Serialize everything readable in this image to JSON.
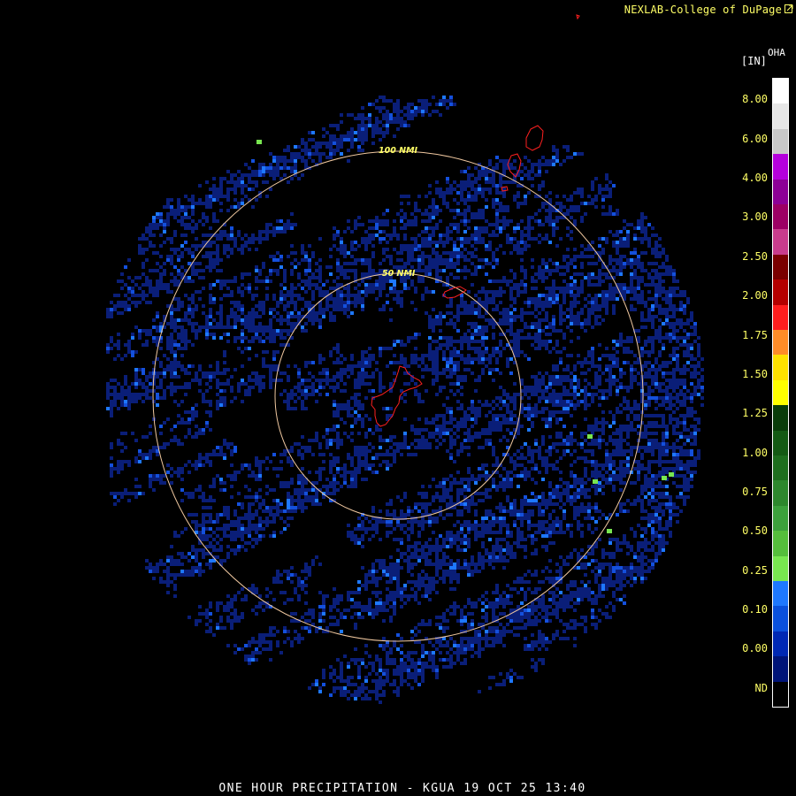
{
  "header": {
    "credit": "NEXLAB-College of DuPage",
    "credit_icon": "external-link-icon"
  },
  "title": "ONE HOUR PRECIPITATION - KGUA 19 OCT 25 13:40",
  "legend": {
    "unit": "[IN]",
    "product": "OHA",
    "labels": [
      "8.00",
      "6.00",
      "4.00",
      "3.00",
      "2.50",
      "2.00",
      "1.75",
      "1.50",
      "1.25",
      "1.00",
      "0.75",
      "0.50",
      "0.25",
      "0.10",
      "0.00",
      "ND"
    ],
    "colors": [
      "#ffffff",
      "#e6e6e6",
      "#c8c8c8",
      "#b400dc",
      "#8c0096",
      "#9c0064",
      "#c83c8c",
      "#7a0000",
      "#b40000",
      "#ff1e1e",
      "#ff8c28",
      "#ffe100",
      "#ffff00",
      "#0a3c0a",
      "#145a14",
      "#1e6e1e",
      "#2d872d",
      "#3ca03c",
      "#55be3c",
      "#78e650",
      "#1e78ff",
      "#0a50dc",
      "#0028b4",
      "#001478",
      "#000000"
    ]
  },
  "map": {
    "station": "KGUA",
    "range_rings": [
      {
        "label": "50 NMI",
        "radius_nmi": 50
      },
      {
        "label": "100 NMI",
        "radius_nmi": 100
      }
    ],
    "ring_color": "#f0c8a0",
    "coast_color": "#ff2020",
    "echo_colors": {
      "light": "#0a1e78",
      "moderate": "#1450dc",
      "bright": "#1e78ff",
      "green": "#78e650"
    }
  }
}
